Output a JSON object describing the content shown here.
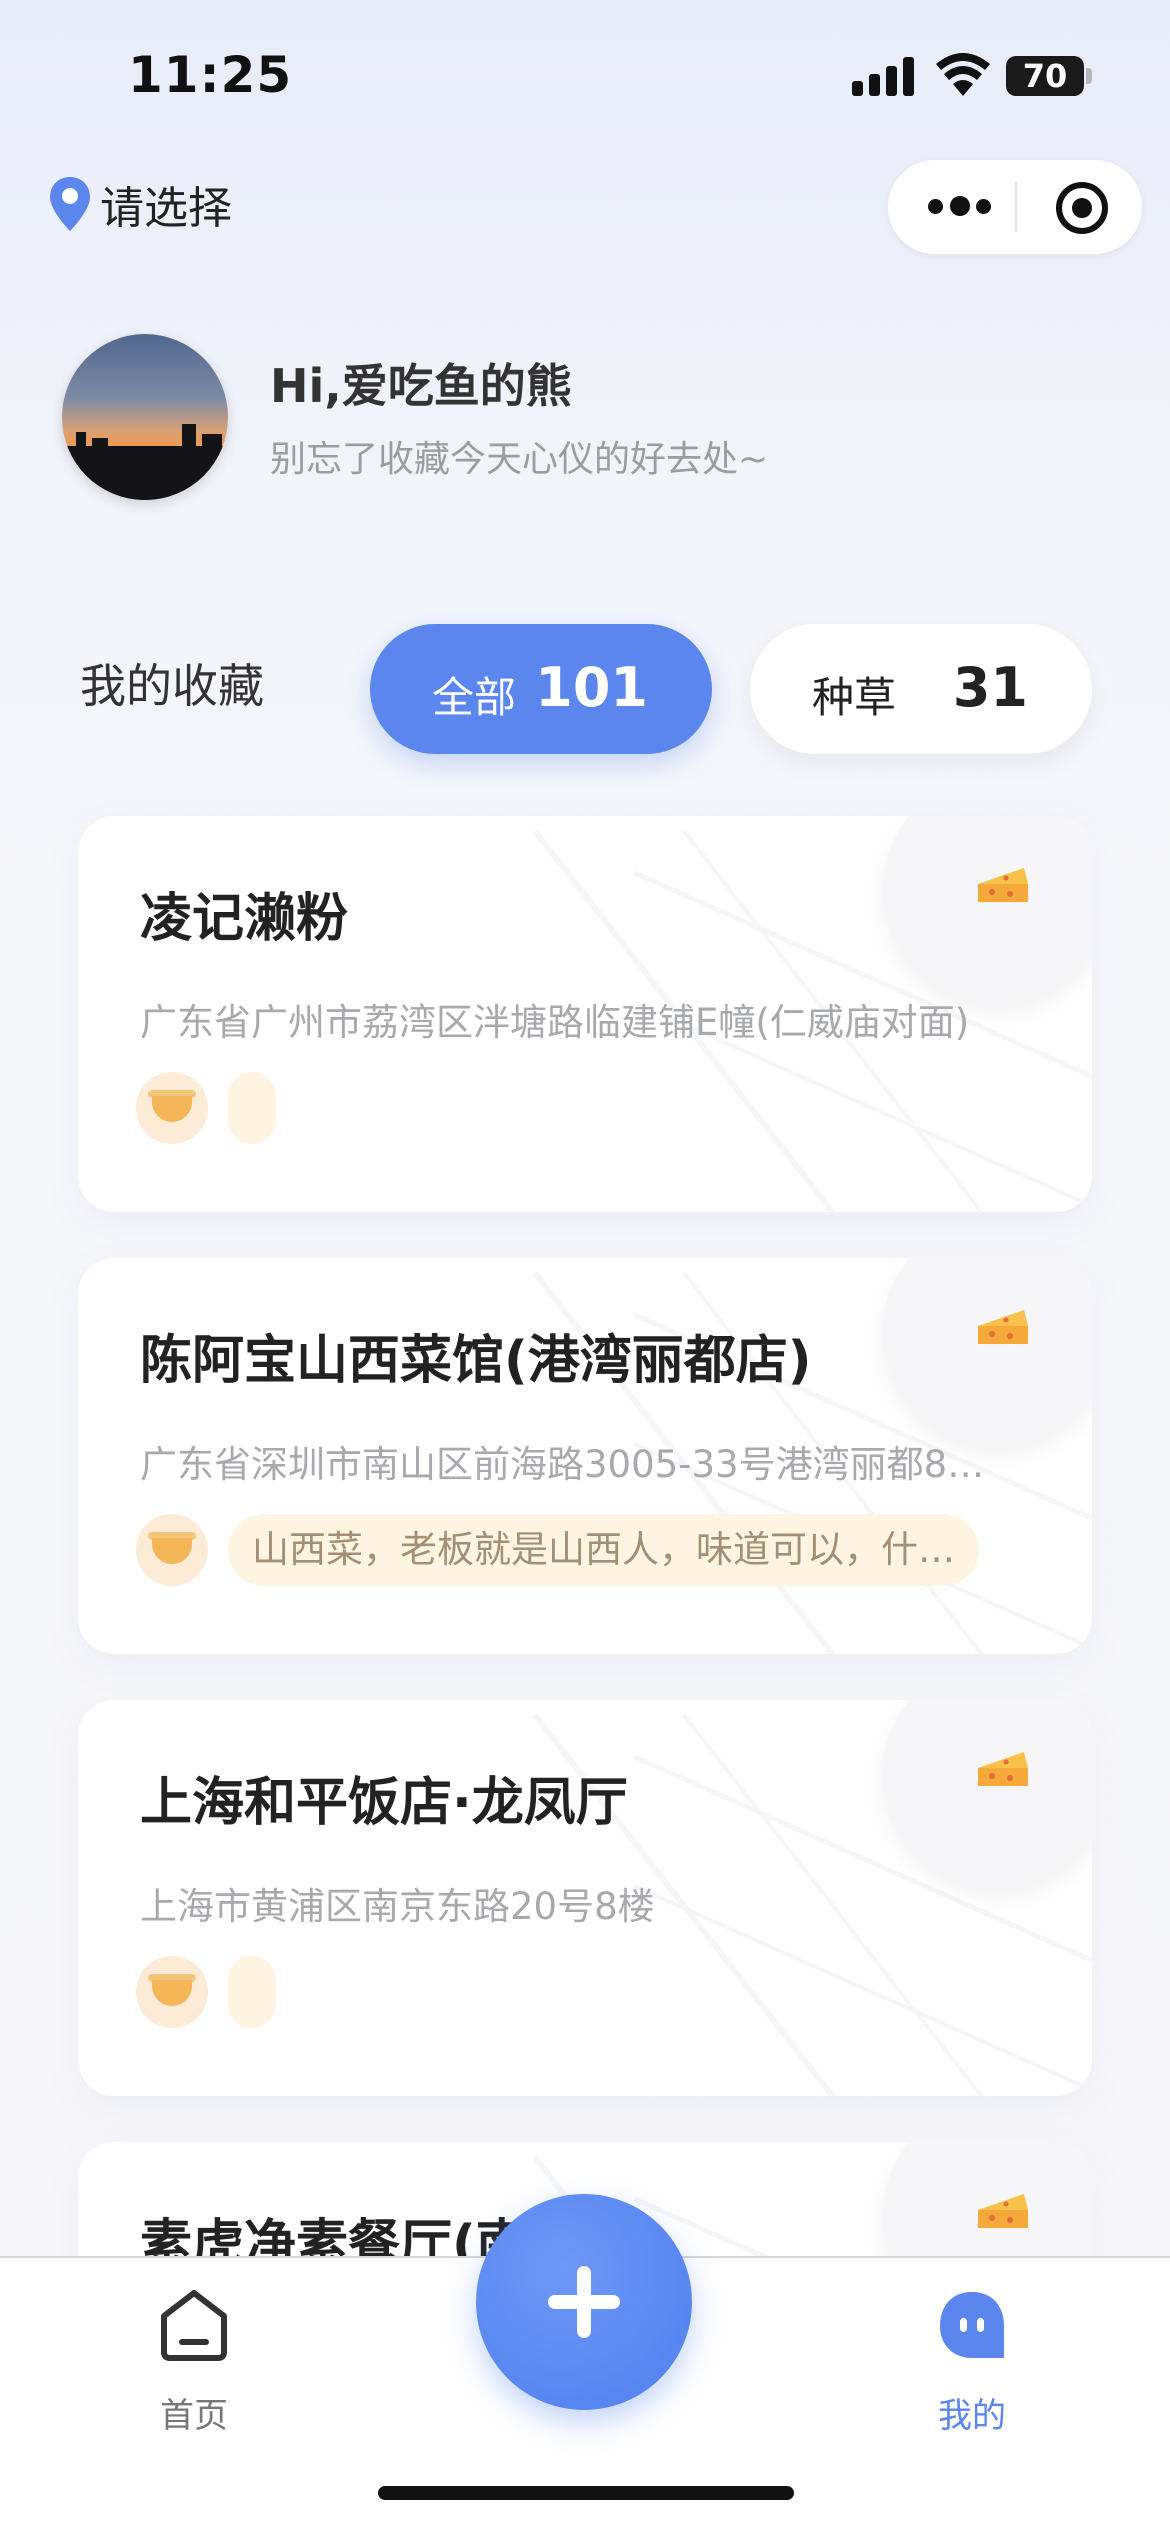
{
  "status_bar": {
    "time": "11:25",
    "battery": "70"
  },
  "header": {
    "location": "请选择"
  },
  "profile": {
    "greeting": "Hi,爱吃鱼的熊",
    "subtitle": "别忘了收藏今天心仪的好去处~"
  },
  "favorites": {
    "title": "我的收藏",
    "filters": [
      {
        "label": "全部",
        "count": "101",
        "selected": true
      },
      {
        "label": "种草",
        "count": "31",
        "selected": false
      }
    ]
  },
  "cards": [
    {
      "title": "凌记濑粉",
      "address": "广东省广州市荔湾区泮塘路临建铺E幢(仁威庙对面)",
      "note": ""
    },
    {
      "title": "陈阿宝山西菜馆(港湾丽都店)",
      "address": "广东省深圳市南山区前海路3005-33号港湾丽都8…",
      "note": "山西菜，老板就是山西人，味道可以，什…"
    },
    {
      "title": "上海和平饭店·龙凤厅",
      "address": "上海市黄浦区南京东路20号8楼",
      "note": ""
    },
    {
      "title": "素虎净素餐厅(南",
      "address": "",
      "note": ""
    }
  ],
  "bottom_nav": {
    "home_label": "首页",
    "mine_label": "我的"
  },
  "colors": {
    "accent": "#5b86ee",
    "chip_bg": "#ffffff",
    "note_bg": "#fdf5e2",
    "note_text": "#a39074"
  },
  "icons": {
    "location": "location-pin-icon",
    "more": "more-dots-icon",
    "close": "close-target-icon",
    "card_corner": "cheese-icon",
    "tag": "noodle-bowl-icon",
    "home": "home-icon",
    "mine": "ghost-icon",
    "add": "plus-icon"
  }
}
